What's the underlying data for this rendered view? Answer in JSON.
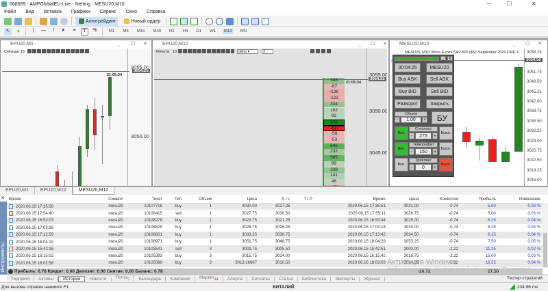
{
  "window": {
    "title": "668689 - AMPGlobalEU-Live - Netting - MESU20,M10"
  },
  "menu": [
    "Файл",
    "Вид",
    "Вставка",
    "Графики",
    "Сервис",
    "Окно",
    "Справка"
  ],
  "toolbar": {
    "algo_label": "Алготрейдинг",
    "new_order_label": "Новый ордер",
    "timeframes": [
      "M1",
      "M5",
      "M15",
      "M30",
      "H1",
      "H4",
      "D1",
      "W1",
      "M10",
      "MN"
    ],
    "active_timeframe": "M10"
  },
  "charts": [
    {
      "title": "EPU20,M1",
      "indicator_label": "Секунда",
      "indicator_value": "15",
      "axis": [
        "3055.00",
        "3050.00"
      ],
      "price": "3054.25",
      "time": "21:05:34",
      "candles": [
        [
          3047.5,
          3047.9,
          3043.0,
          3043.5
        ],
        [
          3044.5,
          3046.9,
          3044.0,
          3045.3
        ],
        [
          3046.0,
          3047.5,
          3044.5,
          3046.2
        ],
        [
          3046.3,
          3050.0,
          3045.8,
          3049.3
        ],
        [
          3049.1,
          3052.3,
          3048.5,
          3052.0
        ],
        [
          3052.0,
          3052.8,
          3049.0,
          3050.1
        ],
        [
          3051.5,
          3052.3,
          3048.0,
          3051.5
        ],
        [
          3051.5,
          3054.5,
          3050.5,
          3054.3
        ]
      ]
    },
    {
      "title": "EPU20,M10",
      "indicator_label": "Минута",
      "indicator_value": "10",
      "mode": "delta",
      "depth": "3",
      "axis": [
        "3055.00",
        "3050.00",
        "3045.00"
      ],
      "price": "3054.25",
      "time": "21:05:34",
      "cluster": [
        348,
        -67,
        -136,
        -123,
        334,
        102,
        82,
        978,
        -493,
        -58,
        -53,
        646,
        232,
        585,
        99,
        338,
        141,
        46,
        -173
      ]
    },
    {
      "title": "MESU20,M10",
      "subtitle": "MESU20, M10:  Micro E-mini S&P 500 ($5): September 2020 CME 1.07",
      "price": "3054.50",
      "axis": [
        "3058.25",
        "3054.50",
        "3051.75",
        "3048.50",
        "3045.25",
        "3042.00",
        "3038.75",
        "3035.50",
        "3032.25",
        "3029.00",
        "3025.75",
        "3022.50",
        "3019.25",
        "3016.00",
        "3012.75"
      ],
      "candles": [
        [
          3033.0,
          3034.5,
          3027.5,
          3029.5
        ],
        [
          3028.5,
          3031.0,
          3023.5,
          3030.0
        ],
        [
          3030.5,
          3031.5,
          3023.0,
          3023.0
        ],
        [
          3023.0,
          3028.5,
          3023.0,
          3026.5
        ],
        [
          3026.5,
          3055.5,
          3026.5,
          3054.5
        ]
      ]
    }
  ],
  "panel": {
    "time": "00:04:25",
    "symbol": "MESU20",
    "buy_ask": "Buy ASK",
    "sell_ask": "Sell ASK",
    "buy_bid": "Buy BID",
    "sell_bid": "Sell BID",
    "reverse": "Разворот",
    "close": "Закрыть",
    "volume_label": "Объем",
    "volume": "1.00",
    "be": "БУ",
    "stoploss_label": "Стоплосс",
    "stoploss": "275",
    "takeprofit_label": "Тейкпрофит",
    "takeprofit": "150",
    "trailing_label": "Трейлинг",
    "trailing": "0",
    "on": "Вкл.",
    "off": "Выкл.",
    "minus": "-",
    "plus": "+"
  },
  "doc_tabs": [
    "EPU20,M1",
    "EPU20,M10",
    "MESU20,M10"
  ],
  "active_doc_tab": "MESU20,M10",
  "toolbox": {
    "side_label": "Инструменты",
    "columns": [
      "Время",
      "Символ",
      "Тикет",
      "Тип",
      "Объем",
      "Цена",
      "S / L",
      "T / P",
      "Время",
      "Цена",
      "Комиссия",
      "Прибыль",
      "Изменение"
    ],
    "rows": [
      [
        "2020.06.15 17:35:56",
        "mesu20",
        "10107718",
        "buy",
        "1",
        "3030.00",
        "3027.25",
        "",
        "2020.06.15 17:36:51",
        "3031.00",
        "-0.74",
        "5.00",
        "0.03 %"
      ],
      [
        "2020.06.15 17:54:40",
        "mesu20",
        "10108415",
        "sell",
        "1",
        "3027.75",
        "3030.50",
        "",
        "2020.06.15 17:55:11",
        "3026.75",
        "-0.74",
        "5.00",
        "0.03 %"
      ],
      [
        "2020.06.15 16:53:03",
        "mesu20",
        "10106278",
        "buy",
        "1",
        "3023.75",
        "3021.25",
        "",
        "2020.06.15 16:53:44",
        "3025.00",
        "-0.74",
        "6.25",
        "0.04 %"
      ],
      [
        "2020.06.15 17:03:36",
        "mesu20",
        "10106528",
        "buy",
        "1",
        "3028.75",
        "3026.25",
        "",
        "2020.06.15 17:04:18",
        "3030.00",
        "-0.74",
        "6.25",
        "0.04 %"
      ],
      [
        "2020.06.15 17:12:59",
        "mesu20",
        "10106821",
        "buy",
        "1",
        "3033.25",
        "3030.75",
        "",
        "2020.06.15 17:13:42",
        "3034.50",
        "-0.74",
        "6.25",
        "0.04 %"
      ],
      [
        "2020.06.15 18:04:19",
        "mesu20",
        "10108971",
        "buy",
        "1",
        "3051.75",
        "3048.75",
        "",
        "2020.06.15 18:04:26",
        "3053.25",
        "-0.74",
        "7.50",
        "0.05 %"
      ],
      [
        "2020.06.15 15:42:16",
        "mesu20",
        "10103541",
        "sell",
        "3",
        "3003.75",
        "3005.50",
        "",
        "2020.06.15 15:42:51",
        "3003.00",
        "-2.22",
        "11.25",
        "0.02 %"
      ],
      [
        "2020.06.15 16:15:02",
        "mesu20",
        "10105393",
        "buy",
        "3",
        "3015.75",
        "3014.00",
        "",
        "2020.06.15 16:15:42",
        "3016.75",
        "-2.22",
        "15.00",
        "0.03 %"
      ],
      [
        "2020.06.15 16:02:58",
        "mesu20",
        "10105080",
        "buy",
        "3",
        "3013.16667",
        "3010.50",
        "",
        "2020.06.15 16:03:03",
        "3014.25",
        "-2.22",
        "16.25",
        "0.04 %"
      ]
    ],
    "summary": "Прибыль: 6.78  Кредит: 0.00  Депозит: 0.00  Снятие: 0.00  Баланс: 6.78",
    "total_commission": "-20.72",
    "total_profit": "27.50",
    "tabs": [
      "Торговля",
      "Активы",
      "История",
      "Новости",
      "Почта",
      "Календарь",
      "Компания",
      "Маркет",
      "Алерты",
      "Сигналы",
      "Статьи",
      "Библиотека",
      "Эксперты",
      "Журнал"
    ],
    "active_tab": "История",
    "mail_badge": "7",
    "market_badge": "44",
    "tester_label": "Тестер стратегий"
  },
  "watermark": {
    "title": "Активация Windows",
    "text": "Чтобы активировать Windows, перейдите в раздел \"Параметры\"."
  },
  "status": {
    "help": "Для вызова справки нажмите F1",
    "user": "ВИТАЛИЙ",
    "ping": "234.96 ms"
  },
  "colors": {
    "up": "#1e8a1e",
    "down": "#ff1a1a",
    "panel_on": "#33bb33",
    "panel_off": "#e8533c",
    "profit": "#2a3bd6"
  }
}
